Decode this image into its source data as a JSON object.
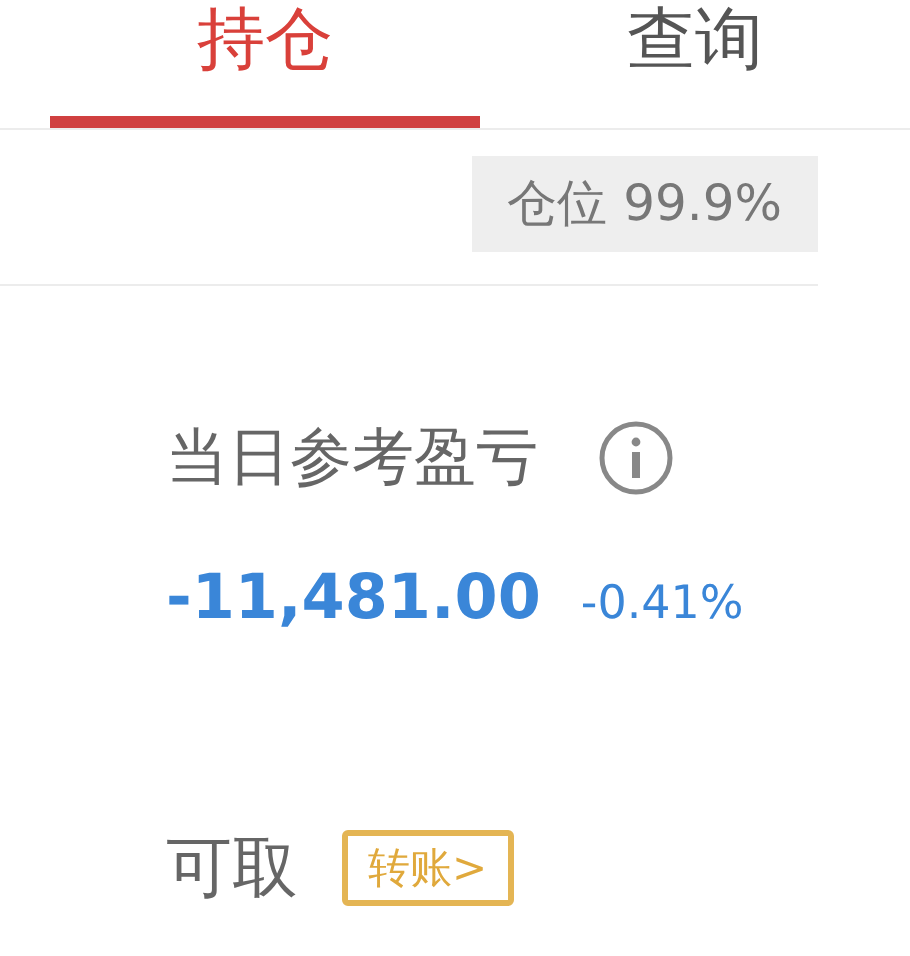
{
  "tabs": [
    {
      "label": "持仓",
      "selected": true
    },
    {
      "label": "查询",
      "selected": false
    }
  ],
  "position_badge": "仓位 99.9%",
  "daily_pnl": {
    "label": "当日参考盈亏",
    "value": "-11,481.00",
    "percent": "-0.41%"
  },
  "withdrawable": {
    "label": "可取",
    "transfer_button": "转账>"
  }
}
